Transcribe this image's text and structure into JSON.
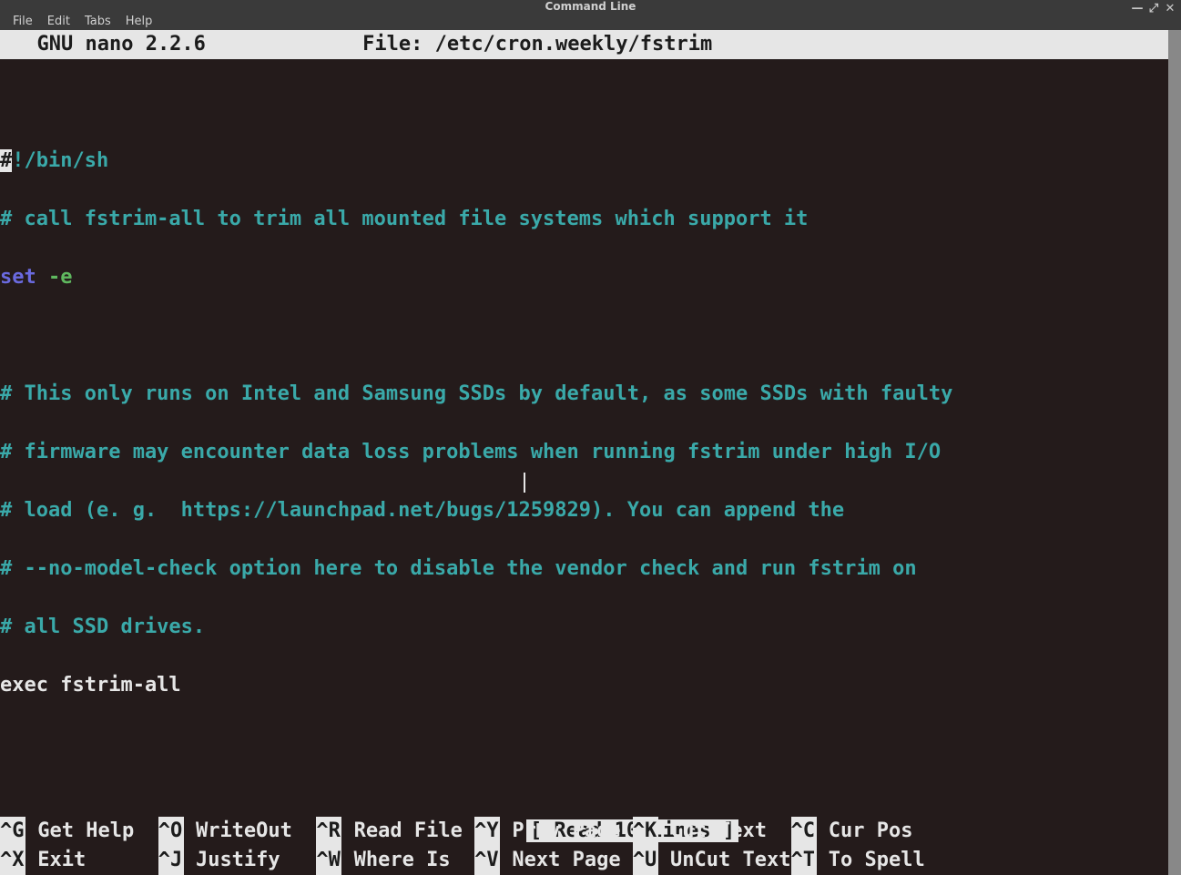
{
  "window": {
    "title": "Command Line"
  },
  "menubar": {
    "items": [
      "File",
      "Edit",
      "Tabs",
      "Help"
    ]
  },
  "nano": {
    "header_left": "  GNU nano 2.2.6",
    "header_center": "File: /etc/cron.weekly/fstrim",
    "status": "[ Read 10 lines ]"
  },
  "content": {
    "l0_hash": "#",
    "l0_rest": "!/bin/sh",
    "l1": "# call fstrim-all to trim all mounted file systems which support it",
    "l2_set": "set",
    "l2_flag": " -e",
    "l3": "",
    "l4": "# This only runs on Intel and Samsung SSDs by default, as some SSDs with faulty",
    "l5": "# firmware may encounter data loss problems when running fstrim under high I/O",
    "l6": "# load (e. g.  https://launchpad.net/bugs/1259829). You can append the",
    "l7": "# --no-model-check option here to disable the vendor check and run fstrim on",
    "l8": "# all SSD drives.",
    "l9": "exec fstrim-all"
  },
  "shortcuts": {
    "row1": [
      {
        "key": "^G",
        "label": " Get Help  "
      },
      {
        "key": "^O",
        "label": " WriteOut  "
      },
      {
        "key": "^R",
        "label": " Read File "
      },
      {
        "key": "^Y",
        "label": " Prev Page "
      },
      {
        "key": "^K",
        "label": " Cut Text  "
      },
      {
        "key": "^C",
        "label": " Cur Pos"
      }
    ],
    "row2": [
      {
        "key": "^X",
        "label": " Exit      "
      },
      {
        "key": "^J",
        "label": " Justify   "
      },
      {
        "key": "^W",
        "label": " Where Is  "
      },
      {
        "key": "^V",
        "label": " Next Page "
      },
      {
        "key": "^U",
        "label": " UnCut Text"
      },
      {
        "key": "^T",
        "label": " To Spell"
      }
    ]
  }
}
